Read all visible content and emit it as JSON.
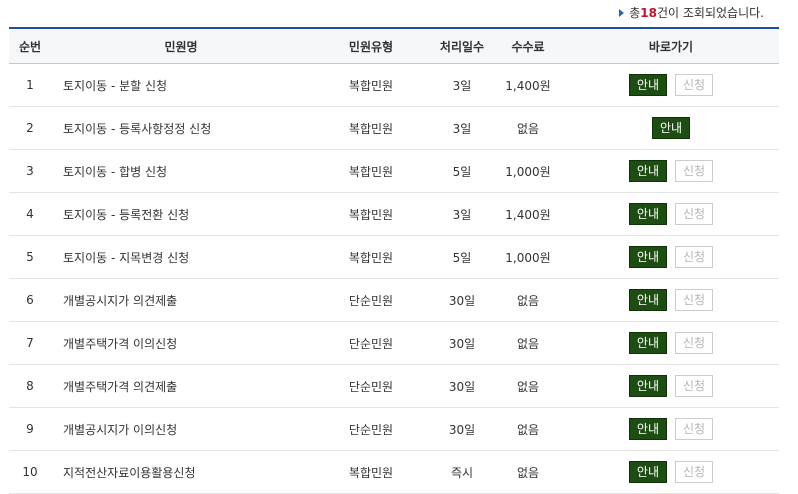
{
  "summary": {
    "prefix": "총 ",
    "count": "18",
    "suffix": "건이 조회되었습니다."
  },
  "columns": [
    "순번",
    "민원명",
    "민원유형",
    "처리일수",
    "수수료",
    "바로가기"
  ],
  "buttons": {
    "guide": "안내",
    "apply": "신청"
  },
  "rows": [
    {
      "no": "1",
      "name": "토지이동 - 분할 신청",
      "type": "복합민원",
      "days": "3일",
      "fee": "1,400원",
      "apply": true
    },
    {
      "no": "2",
      "name": "토지이동 - 등록사항정정 신청",
      "type": "복합민원",
      "days": "3일",
      "fee": "없음",
      "apply": false
    },
    {
      "no": "3",
      "name": "토지이동 - 합병 신청",
      "type": "복합민원",
      "days": "5일",
      "fee": "1,000원",
      "apply": true
    },
    {
      "no": "4",
      "name": "토지이동 - 등록전환 신청",
      "type": "복합민원",
      "days": "3일",
      "fee": "1,400원",
      "apply": true
    },
    {
      "no": "5",
      "name": "토지이동 - 지목변경 신청",
      "type": "복합민원",
      "days": "5일",
      "fee": "1,000원",
      "apply": true
    },
    {
      "no": "6",
      "name": "개별공시지가 의견제출",
      "type": "단순민원",
      "days": "30일",
      "fee": "없음",
      "apply": true
    },
    {
      "no": "7",
      "name": "개별주택가격 이의신청",
      "type": "단순민원",
      "days": "30일",
      "fee": "없음",
      "apply": true
    },
    {
      "no": "8",
      "name": "개별주택가격 의견제출",
      "type": "단순민원",
      "days": "30일",
      "fee": "없음",
      "apply": true
    },
    {
      "no": "9",
      "name": "개별공시지가 이의신청",
      "type": "단순민원",
      "days": "30일",
      "fee": "없음",
      "apply": true
    },
    {
      "no": "10",
      "name": "지적전산자료이용활용신청",
      "type": "복합민원",
      "days": "즉시",
      "fee": "없음",
      "apply": true
    }
  ]
}
